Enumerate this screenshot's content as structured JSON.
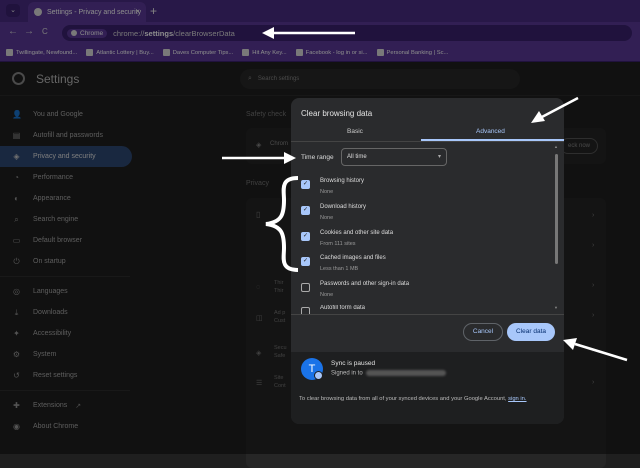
{
  "browser": {
    "tab_title": "Settings - Privacy and security",
    "tab_close": "×",
    "new_tab": "+",
    "tab_dropdown": "⌄",
    "nav_back": "←",
    "nav_forward": "→",
    "nav_reload": "C",
    "nav_home": "⌂",
    "chip_label": "Chrome",
    "url_prefix": "chrome://",
    "url_bold": "settings",
    "url_suffix": "/clearBrowserData"
  },
  "bookmarks": [
    {
      "label": "Twillingate, Newfound..."
    },
    {
      "label": "Atlantic Lottery | Buy..."
    },
    {
      "label": "Daves Computer Tips..."
    },
    {
      "label": "Hit Any Key..."
    },
    {
      "label": "Facebook - log in or si..."
    },
    {
      "label": "Personal Banking | Sc..."
    }
  ],
  "settings": {
    "title": "Settings",
    "search_placeholder": "Search settings",
    "sidebar": [
      {
        "label": "You and Google",
        "icon": "person-icon",
        "glyph": "👤"
      },
      {
        "label": "Autofill and passwords",
        "icon": "clipboard-icon",
        "glyph": "▤"
      },
      {
        "label": "Privacy and security",
        "icon": "shield-icon",
        "glyph": "◈",
        "active": true
      },
      {
        "label": "Performance",
        "icon": "speedometer-icon",
        "glyph": "◔"
      },
      {
        "label": "Appearance",
        "icon": "palette-icon",
        "glyph": "◐"
      },
      {
        "label": "Search engine",
        "icon": "search-icon",
        "glyph": "⌕"
      },
      {
        "label": "Default browser",
        "icon": "browser-icon",
        "glyph": "▭"
      },
      {
        "label": "On startup",
        "icon": "power-icon",
        "glyph": "⏻"
      },
      {
        "label": "Languages",
        "icon": "globe-icon",
        "glyph": "◎"
      },
      {
        "label": "Downloads",
        "icon": "download-icon",
        "glyph": "⤓"
      },
      {
        "label": "Accessibility",
        "icon": "accessibility-icon",
        "glyph": "✦"
      },
      {
        "label": "System",
        "icon": "wrench-icon",
        "glyph": "⚙"
      },
      {
        "label": "Reset settings",
        "icon": "reset-icon",
        "glyph": "↺"
      },
      {
        "label": "Extensions",
        "icon": "puzzle-icon",
        "glyph": "✚"
      },
      {
        "label": "About Chrome",
        "icon": "chrome-icon",
        "glyph": "◉"
      }
    ],
    "safety_check_label": "Safety check",
    "safety_check_row": "Chrom",
    "check_now": "eck now",
    "privacy_label": "Privacy",
    "privacy_rows": [
      {
        "title": "Thir",
        "sub": "Thir"
      },
      {
        "title": "Ad p",
        "sub": "Cust"
      },
      {
        "title": "Secu",
        "sub": "Safe"
      },
      {
        "title": "Site",
        "sub": "Cont"
      }
    ]
  },
  "dialog": {
    "title": "Clear browsing data",
    "tabs": {
      "basic": "Basic",
      "advanced": "Advanced"
    },
    "time_range_label": "Time range",
    "time_range_value": "All time",
    "options": [
      {
        "label": "Browsing history",
        "sub": "None",
        "checked": true
      },
      {
        "label": "Download history",
        "sub": "None",
        "checked": true
      },
      {
        "label": "Cookies and other site data",
        "sub": "From 111 sites",
        "checked": true
      },
      {
        "label": "Cached images and files",
        "sub": "Less than 1 MB",
        "checked": true
      },
      {
        "label": "Passwords and other sign-in data",
        "sub": "None",
        "checked": false
      },
      {
        "label": "Autofill form data",
        "sub": "",
        "checked": false
      }
    ],
    "cancel": "Cancel",
    "clear": "Clear data",
    "sync_avatar": "T",
    "sync_title": "Sync is paused",
    "signed_in": "Signed in to",
    "footnote_text": "To clear browsing data from all of your synced devices and your Google Account,",
    "footnote_link": "sign in."
  },
  "colors": {
    "accent": "#a8c7fa",
    "browser_purple": "#5b3a99",
    "annotation_arrow": "#ffffff"
  }
}
